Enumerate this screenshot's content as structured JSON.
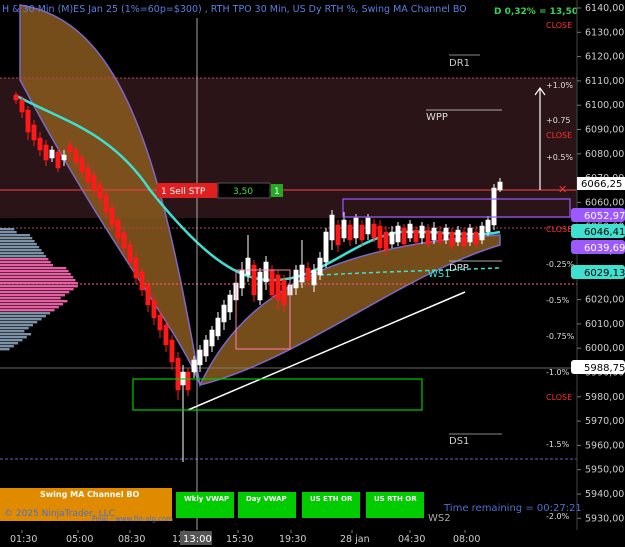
{
  "header": {
    "title": "H & 30 Min (M)ES Jan 25 (1%=60p=$300) , RTH TPO 30 Min, US Dy RTH %, Swing MA Channel BO",
    "delta": "D 0,32% = 13,50"
  },
  "price_axis": {
    "ticks": [
      "6140,00",
      "6130,00",
      "6120,00",
      "6110,00",
      "6100,00",
      "6090,00",
      "6080,00",
      "6070,00",
      "6060,00",
      "6050,00",
      "6040,00",
      "6030,00",
      "6020,00",
      "6010,00",
      "6000,00",
      "5990,00",
      "5980,00",
      "5970,00",
      "5960,00",
      "5950,00",
      "5940,00",
      "5930,00"
    ],
    "current_price": "6066,25",
    "price_boxes": [
      "6052,97",
      "6046,41",
      "6039,69",
      "6029,13",
      "5988,75"
    ]
  },
  "time_axis": {
    "ticks": [
      "01:30",
      "05:00",
      "08:30",
      "12:00",
      "15:30",
      "19:30",
      "28 jan",
      "04:30",
      "08:00"
    ],
    "crosshair_label": "13:00"
  },
  "levels": {
    "close": "CLOSE",
    "dr1": "DR1",
    "wpp": "WPP",
    "dpp": "DPP",
    "ws1": "WS1",
    "ds1": "DS1",
    "ws2": "WS2",
    "pcts": [
      "+1.0%",
      "+0.75",
      "+0.5%",
      "-0.25%",
      "-0.5%",
      "-0.75%",
      "-1.0%",
      "-1.5%",
      "-2.0%"
    ]
  },
  "order": {
    "label": "1 Sell STP",
    "value": "3,50",
    "qty": "1"
  },
  "bottom_bar": {
    "swing_label": "Swing MA Channel BO",
    "buttons": [
      "Wkly VWAP",
      "Day VWAP",
      "US ETH OR",
      "US RTH OR"
    ],
    "copyright": "© 2025 NinjaTrader, LLC",
    "website": "Final - www.fin-alg.com",
    "time_remaining": "Time remaining = 00:27:21"
  },
  "colors": {
    "channel_fill": "#8a5a1e",
    "channel_edge": "#7b68c8",
    "cyan_ma": "#40e0d0",
    "up_candle": "#ffffff",
    "down_candle": "#ff1a1a",
    "profile_pink": "#ff69b4",
    "close_red": "#ff3030",
    "green_button": "#00cc00",
    "orange_label": "#e08a00",
    "delta_green": "#39d353"
  }
}
